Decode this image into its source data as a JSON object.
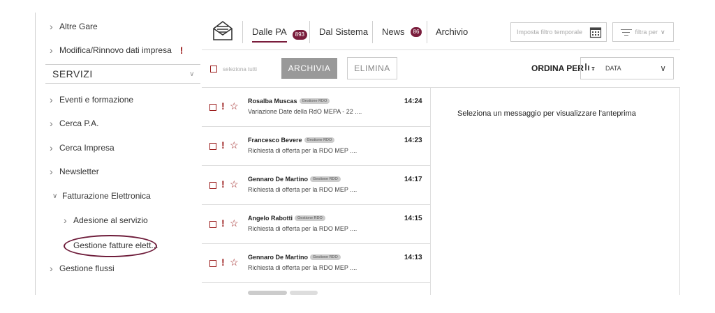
{
  "sidebar": {
    "items_top": [
      {
        "label": "Altre Gare"
      },
      {
        "label": "Modifica/Rinnovo dati impresa",
        "warning": "!"
      }
    ],
    "section_title": "SERVIZI",
    "items": [
      {
        "label": "Eventi e formazione"
      },
      {
        "label": "Cerca P.A."
      },
      {
        "label": "Cerca Impresa"
      },
      {
        "label": "Newsletter"
      },
      {
        "label": "Fatturazione Elettronica"
      },
      {
        "label": "Adesione al servizio"
      },
      {
        "label": "Gestione fatture elett..."
      },
      {
        "label": "Gestione flussi"
      }
    ]
  },
  "tabs": [
    {
      "label": "Dalle PA",
      "badge": "893"
    },
    {
      "label": "Dal Sistema"
    },
    {
      "label": "News",
      "badge": "86"
    },
    {
      "label": "Archivio"
    }
  ],
  "filters": {
    "date_placeholder": "Imposta filtro temporale",
    "filter_label": "filtra per"
  },
  "actions": {
    "select_all": "seleziona tutti",
    "archive": "ARCHIVIA",
    "delete": "ELIMINA",
    "sort_label": "ORDINA PER",
    "sort_value": "DATA"
  },
  "messages": [
    {
      "sender": "Rosalba Muscas",
      "tag": "Gestione RDO",
      "subject": "Variazione Date della RdO MEPA - 22 ....",
      "time": "14:24"
    },
    {
      "sender": "Francesco Bevere",
      "tag": "Gestione RDO",
      "subject": "Richiesta di offerta per la RDO MEP ....",
      "time": "14:23"
    },
    {
      "sender": "Gennaro De Martino",
      "tag": "Gestione RDO",
      "subject": "Richiesta di offerta per la RDO MEP ....",
      "time": "14:17"
    },
    {
      "sender": "Angelo Rabotti",
      "tag": "Gestione RDO",
      "subject": "Richiesta di offerta per la RDO MEP ....",
      "time": "14:15"
    },
    {
      "sender": "Gennaro De Martino",
      "tag": "Gestione RDO",
      "subject": "Richiesta di offerta per la RDO MEP ....",
      "time": "14:13"
    }
  ],
  "preview": {
    "placeholder": "Seleziona un messaggio per visualizzare l'anteprima"
  },
  "colors": {
    "accent": "#7a1d3c",
    "warning": "#9b1c1c"
  }
}
